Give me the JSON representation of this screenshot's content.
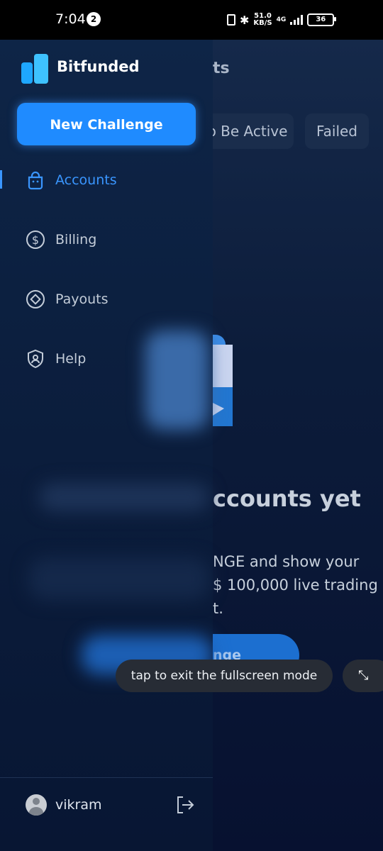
{
  "status_bar": {
    "time": "7:04",
    "notification_count": "2",
    "speed_value": "51.0",
    "speed_unit": "KB/S",
    "network": "4G",
    "battery": "36"
  },
  "background_page": {
    "title_fragment": "ts",
    "tabs": [
      "o Be Active",
      "Failed"
    ],
    "empty_title_fragment": "ccounts yet",
    "empty_desc_lines": [
      "NGE and show your",
      "$ 100,000 live trading",
      "t."
    ],
    "cta_fragment": "enge"
  },
  "drawer": {
    "brand": "Bitfunded",
    "new_challenge_label": "New Challenge",
    "menu": [
      {
        "label": "Accounts",
        "icon": "bag-icon",
        "active": true
      },
      {
        "label": "Billing",
        "icon": "dollar-circle-icon",
        "active": false
      },
      {
        "label": "Payouts",
        "icon": "diamond-circle-icon",
        "active": false
      },
      {
        "label": "Help",
        "icon": "shield-person-icon",
        "active": false
      }
    ],
    "user_name": "vikram"
  },
  "toast": {
    "message": "tap to exit the fullscreen mode"
  },
  "colors": {
    "accent": "#1f8bff",
    "active_text": "#3a96ff",
    "drawer_bg": "#0e2547"
  }
}
